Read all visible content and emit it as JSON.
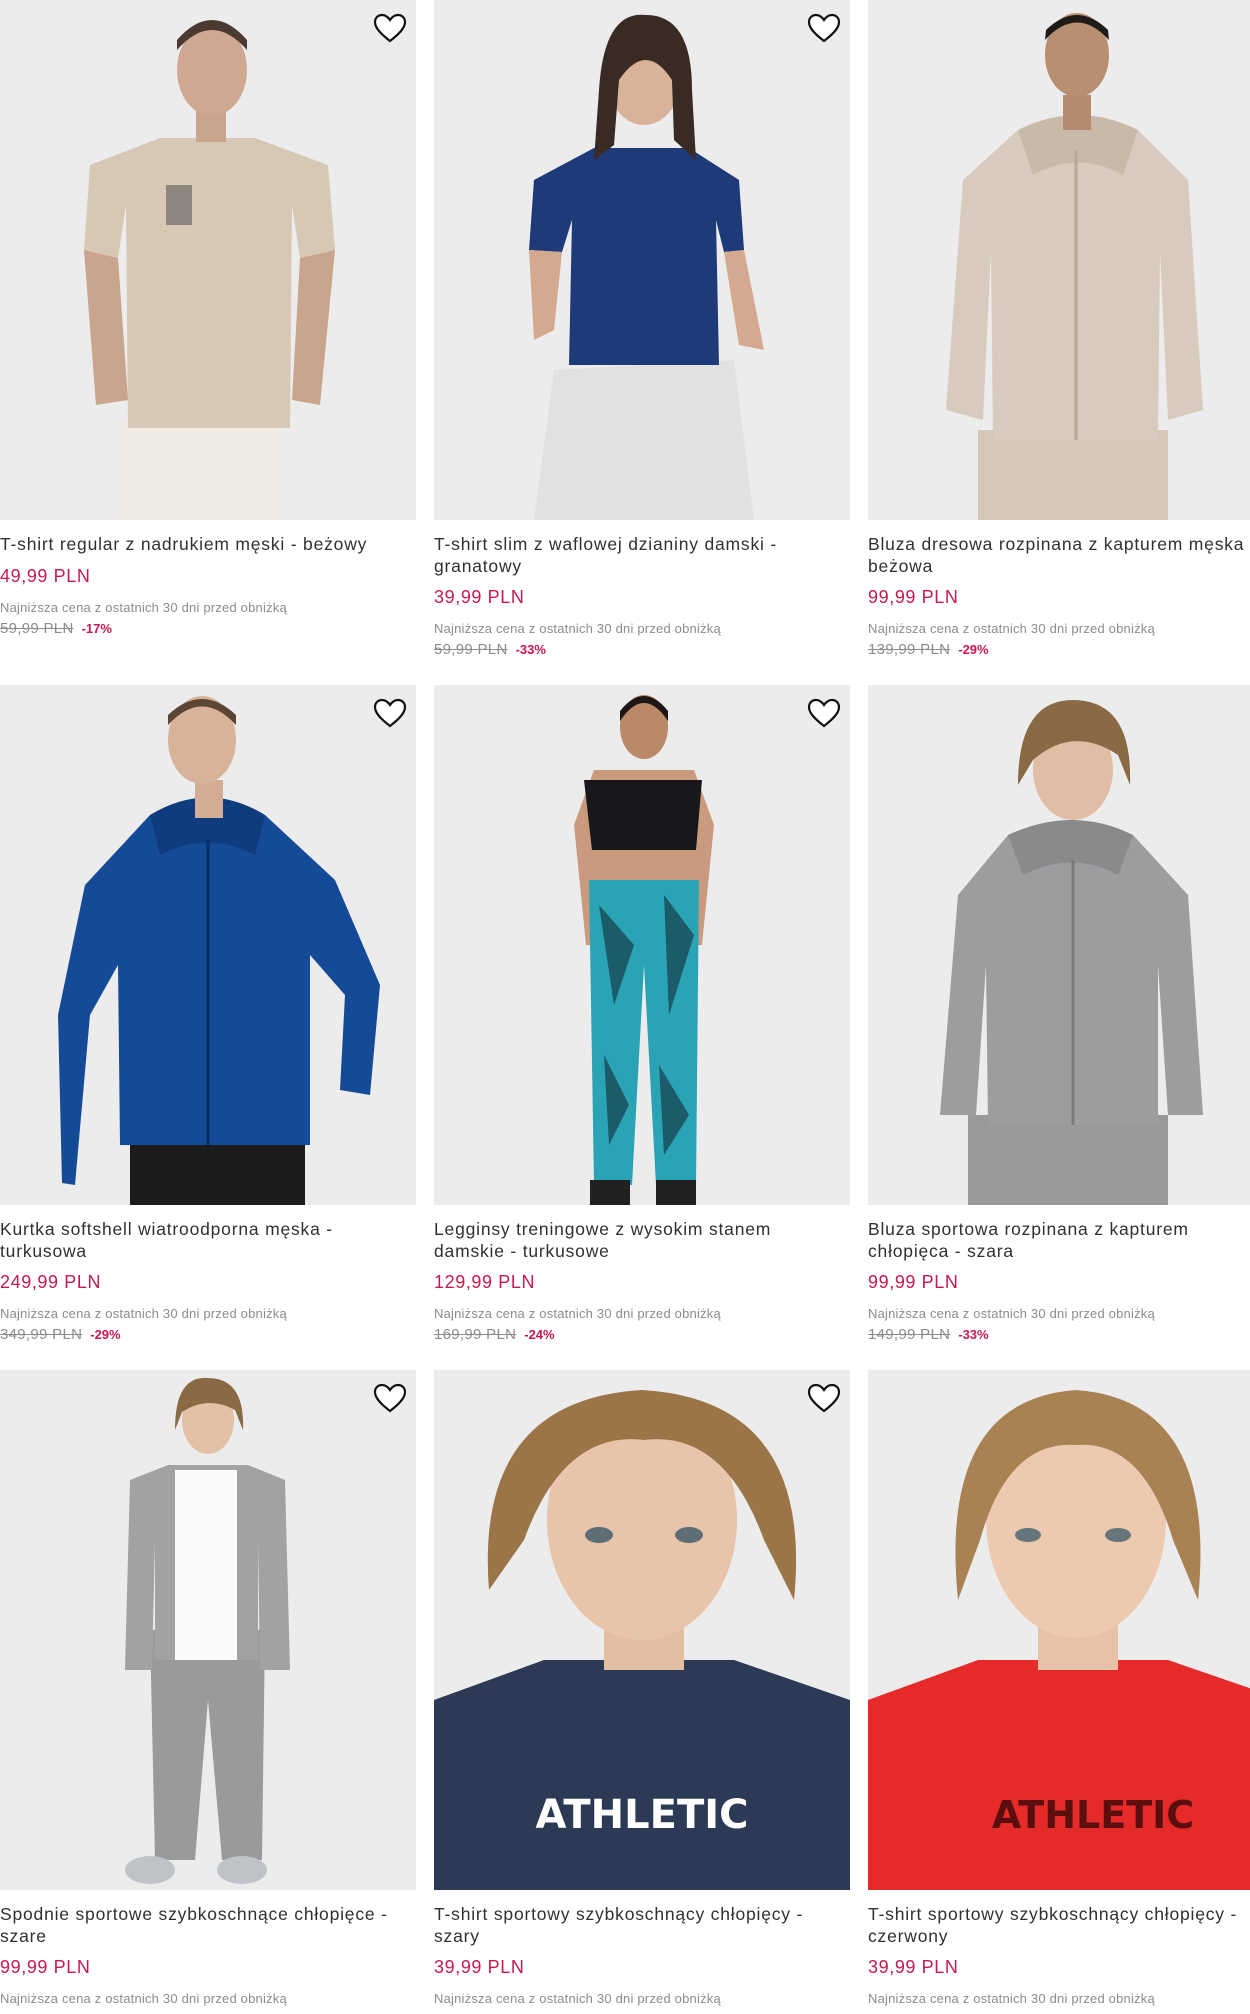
{
  "wishlist_icon": "heart-outline-icon",
  "products": [
    {
      "title_lines": [
        "T-shirt regular z nadrukiem męski - beżowy"
      ],
      "price": "49,99 PLN",
      "lowest_label": "Najniższa cena z ostatnich 30 dni przed obniżką",
      "old_price": "59,99 PLN",
      "discount": "-17%",
      "image": "man-beige-tshirt-photo"
    },
    {
      "title_lines": [
        "T-shirt slim z waflowej dzianiny damski -",
        "granatowy"
      ],
      "price": "39,99 PLN",
      "lowest_label": "Najniższa cena z ostatnich 30 dni przed obniżką",
      "old_price": "59,99 PLN",
      "discount": "-33%",
      "image": "woman-navy-tshirt-photo"
    },
    {
      "title_lines": [
        "Bluza dresowa rozpinana z kapturem męska -",
        "beżowa"
      ],
      "price": "99,99 PLN",
      "lowest_label": "Najniższa cena z ostatnich 30 dni przed obniżką",
      "old_price": "139,99 PLN",
      "discount": "-29%",
      "image": "man-beige-hoodie-photo"
    },
    {
      "title_lines": [
        "Kurtka softshell wiatroodporna męska -",
        "turkusowa"
      ],
      "price": "249,99 PLN",
      "lowest_label": "Najniższa cena z ostatnich 30 dni przed obniżką",
      "old_price": "349,99 PLN",
      "discount": "-29%",
      "image": "man-blue-softshell-photo"
    },
    {
      "title_lines": [
        "Legginsy treningowe z wysokim stanem",
        "damskie - turkusowe"
      ],
      "price": "129,99 PLN",
      "lowest_label": "Najniższa cena z ostatnich 30 dni przed obniżką",
      "old_price": "169,99 PLN",
      "discount": "-24%",
      "image": "woman-turquoise-leggings-photo"
    },
    {
      "title_lines": [
        "Bluza sportowa rozpinana z kapturem",
        "chłopięca - szara"
      ],
      "price": "99,99 PLN",
      "lowest_label": "Najniższa cena z ostatnich 30 dni przed obniżką",
      "old_price": "149,99 PLN",
      "discount": "-33%",
      "image": "boy-grey-hoodie-photo"
    },
    {
      "title_lines": [
        "Spodnie sportowe szybkoschnące chłopięce -",
        "szare"
      ],
      "price": "99,99 PLN",
      "lowest_label": "Najniższa cena z ostatnich 30 dni przed obniżką",
      "old_price": "",
      "discount": "",
      "image": "boy-grey-pants-photo"
    },
    {
      "title_lines": [
        "T-shirt sportowy szybkoschnący chłopięcy -",
        "szary"
      ],
      "price": "39,99 PLN",
      "lowest_label": "Najniższa cena z ostatnich 30 dni przed obniżką",
      "old_price": "",
      "discount": "",
      "image": "boy-navy-athletic-tshirt-photo",
      "print_text": "ATHLETIC"
    },
    {
      "title_lines": [
        "T-shirt sportowy szybkoschnący chłopięcy -",
        "czerwony"
      ],
      "price": "39,99 PLN",
      "lowest_label": "Najniższa cena z ostatnich 30 dni przed obniżką",
      "old_price": "",
      "discount": "",
      "image": "boy-red-athletic-tshirt-photo",
      "print_text": "ATHLETIC"
    }
  ],
  "colors": {
    "price": "#c8194f",
    "muted": "#8c8c8c",
    "title": "#303030",
    "photo_bg": "#ececec"
  }
}
